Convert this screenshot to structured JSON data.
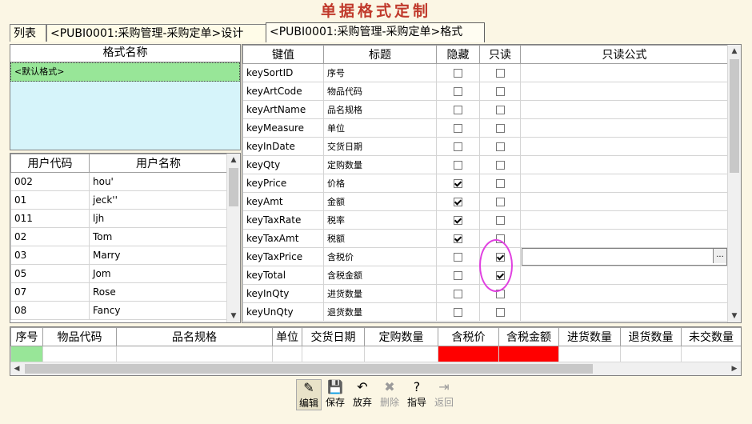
{
  "window": {
    "title": "单据格式定制"
  },
  "tabs": [
    {
      "label": "列表"
    },
    {
      "label": "<PUBI0001:采购管理-采购定单>设计"
    },
    {
      "label": "<PUBI0001:采购管理-采购定单>格式"
    }
  ],
  "format_panel": {
    "header": "格式名称",
    "items": [
      {
        "label": "<默认格式>"
      }
    ],
    "selected_color": "#98e698",
    "empty_color": "#d6f4fa"
  },
  "users_panel": {
    "headers": [
      "用户代码",
      "用户名称"
    ],
    "rows": [
      {
        "code": "002",
        "name": "hou'"
      },
      {
        "code": "01",
        "name": "jeck''"
      },
      {
        "code": "011",
        "name": "ljh"
      },
      {
        "code": "02",
        "name": "Tom"
      },
      {
        "code": "03",
        "name": "Marry"
      },
      {
        "code": "05",
        "name": "Jom"
      },
      {
        "code": "07",
        "name": "Rose"
      },
      {
        "code": "08",
        "name": "Fancy"
      }
    ]
  },
  "fields_panel": {
    "headers": [
      "键值",
      "标题",
      "隐藏",
      "只读",
      "只读公式"
    ],
    "rows": [
      {
        "key": "keySortID",
        "title": "序号",
        "hidden": false,
        "readonly": false
      },
      {
        "key": "keyArtCode",
        "title": "物品代码",
        "hidden": false,
        "readonly": false
      },
      {
        "key": "keyArtName",
        "title": "品名规格",
        "hidden": false,
        "readonly": false
      },
      {
        "key": "keyMeasure",
        "title": "单位",
        "hidden": false,
        "readonly": false
      },
      {
        "key": "keyInDate",
        "title": "交货日期",
        "hidden": false,
        "readonly": false
      },
      {
        "key": "keyQty",
        "title": "定购数量",
        "hidden": false,
        "readonly": false
      },
      {
        "key": "keyPrice",
        "title": "价格",
        "hidden": true,
        "readonly": false
      },
      {
        "key": "keyAmt",
        "title": "金额",
        "hidden": true,
        "readonly": false
      },
      {
        "key": "keyTaxRate",
        "title": "税率",
        "hidden": true,
        "readonly": false
      },
      {
        "key": "keyTaxAmt",
        "title": "税额",
        "hidden": true,
        "readonly": false
      },
      {
        "key": "keyTaxPrice",
        "title": "含税价",
        "hidden": false,
        "readonly": true
      },
      {
        "key": "keyTotal",
        "title": "含税金额",
        "hidden": false,
        "readonly": true
      },
      {
        "key": "keyInQty",
        "title": "进货数量",
        "hidden": false,
        "readonly": false
      },
      {
        "key": "keyUnQty",
        "title": "退货数量",
        "hidden": false,
        "readonly": false
      }
    ],
    "formula_button": "...",
    "highlight_color": "#e040e0"
  },
  "preview_grid": {
    "headers": [
      "序号",
      "物品代码",
      "品名规格",
      "单位",
      "交货日期",
      "定购数量",
      "含税价",
      "含税金额",
      "进货数量",
      "退货数量",
      "未交数量"
    ],
    "readonly_color": "#ff0000",
    "row_marker_color": "#98e698"
  },
  "toolbar": {
    "buttons": [
      {
        "label": "编辑",
        "icon": "edit-icon",
        "glyph": "✎",
        "disabled": false,
        "selected": true
      },
      {
        "label": "保存",
        "icon": "save-icon",
        "glyph": "💾",
        "disabled": false,
        "selected": false
      },
      {
        "label": "放弃",
        "icon": "undo-icon",
        "glyph": "↶",
        "disabled": false,
        "selected": false
      },
      {
        "label": "删除",
        "icon": "delete-icon",
        "glyph": "✖",
        "disabled": true,
        "selected": false
      },
      {
        "label": "指导",
        "icon": "help-icon",
        "glyph": "?",
        "disabled": false,
        "selected": false
      },
      {
        "label": "返回",
        "icon": "exit-icon",
        "glyph": "⇥",
        "disabled": true,
        "selected": false
      }
    ]
  }
}
